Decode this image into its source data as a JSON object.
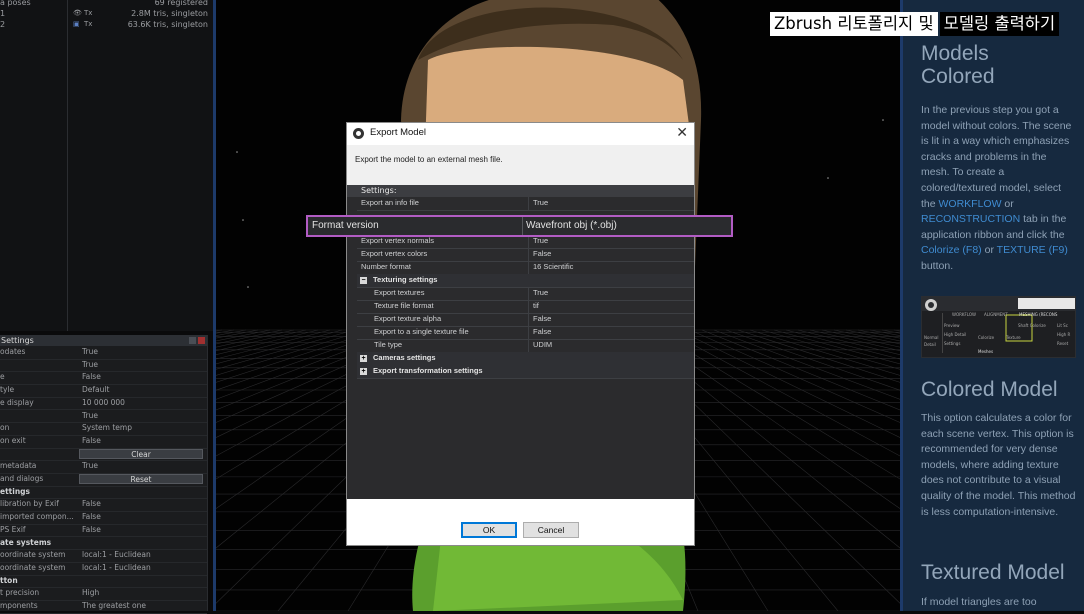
{
  "outliner": {
    "rows": [
      {
        "name": "a poses",
        "info": "69 registered"
      },
      {
        "name": "1",
        "eye": "👁",
        "tag": "Tx",
        "info": "2.8M tris, singleton"
      },
      {
        "name": "2",
        "eye": "▣",
        "tag": "Tx",
        "info": "63.6K tris, singleton"
      }
    ]
  },
  "settings_panel": {
    "title": "Settings",
    "rows": [
      {
        "k": "odates",
        "v": "True"
      },
      {
        "k": "",
        "v": "True"
      },
      {
        "k": "e",
        "v": "False"
      },
      {
        "k": "tyle",
        "v": "Default"
      },
      {
        "k": "e display",
        "v": "10 000 000"
      },
      {
        "k": "",
        "v": "True"
      },
      {
        "k": "on",
        "v": "System temp"
      },
      {
        "k": "on exit",
        "v": "False"
      },
      {
        "k": "",
        "button": "Clear"
      },
      {
        "k": "metadata",
        "v": "True"
      },
      {
        "k": "and dialogs",
        "button": "Reset"
      },
      {
        "k": "ettings",
        "section": true
      },
      {
        "k": "libration by Exif",
        "v": "False"
      },
      {
        "k": "imported compon...",
        "v": "False"
      },
      {
        "k": "PS Exif",
        "v": "False"
      },
      {
        "k": "ate systems",
        "section": true
      },
      {
        "k": "oordinate system",
        "v": "local:1 - Euclidean"
      },
      {
        "k": "oordinate system",
        "v": "local:1 - Euclidean"
      },
      {
        "k": "tton",
        "section": true
      },
      {
        "k": "t precision",
        "v": "High"
      },
      {
        "k": "mponents",
        "v": "The greatest one"
      }
    ]
  },
  "banner": {
    "white_text": "Zbrush 리토폴리지 및",
    "black_text": "모델링 출력하기"
  },
  "help": {
    "heading1_line1": "Models",
    "heading1_line2": "Colored",
    "para1": "In the previous step you got a model without colors. The scene is lit in a way which emphasizes cracks and problems in the mesh. To create a colored/textured model, select the ",
    "link_workflow": "WORKFLOW",
    "para1_or": " or ",
    "link_reconstruction": "RECONSTRUCTION",
    "para1_b": " tab in the application ribbon and click the ",
    "link_colorize": "Colorize (F8)",
    "para1_c": " or ",
    "link_texture": "TEXTURE (F9)",
    "para1_d": " button.",
    "heading2": "Colored Model",
    "para2": "This option calculates a color for each scene vertex. This option is recommended for very dense models, where adding texture does not contribute to a visual quality of the model. This method is less computation-intensive.",
    "heading3": "Textured Model",
    "para3": "If model triangles are too",
    "thumb": {
      "tabs": [
        "WORKFLOW",
        "ALIGNMENT",
        "MESHING (RECONS"
      ],
      "left_labels": [
        "Preview",
        "High Detail",
        "Settings"
      ],
      "bottom_labels": [
        "Normal",
        "Detail"
      ],
      "mid_labels": [
        "Colorize",
        "Texture"
      ],
      "right_labels": [
        "Shaft Colorize",
        "Lit Sc",
        "High R",
        "Reset"
      ],
      "footer": "Meshes"
    }
  },
  "dialog": {
    "title": "Export Model",
    "description": "Export the model to an external mesh file.",
    "settings_header": "Settings:",
    "rows": [
      {
        "k": "Export an info file",
        "v": "True"
      },
      {
        "k": "Export vertex normals",
        "v": "True"
      },
      {
        "k": "Export vertex colors",
        "v": "False"
      },
      {
        "k": "Number format",
        "v": "16 Scientific"
      },
      {
        "k": "Texturing settings",
        "group": "open"
      },
      {
        "k": "Export textures",
        "v": "True",
        "sub": true
      },
      {
        "k": "Texture file format",
        "v": "tif",
        "sub": true
      },
      {
        "k": "Export texture alpha",
        "v": "False",
        "sub": true
      },
      {
        "k": "Export to a single texture file",
        "v": "False",
        "sub": true
      },
      {
        "k": "Tile type",
        "v": "UDIM",
        "sub": true
      },
      {
        "k": "Cameras settings",
        "group": "closed"
      },
      {
        "k": "Export transformation settings",
        "group": "closed"
      }
    ],
    "popout": {
      "k": "Format version",
      "v": "Wavefront obj (*.obj)"
    },
    "ok_label": "OK",
    "cancel_label": "Cancel",
    "close_symbol": "✕"
  },
  "colors": {
    "help_bg": "#16293f",
    "link": "#3f8bd0",
    "highlight_border": "#b25cc4",
    "ok_border": "#0078d7"
  }
}
